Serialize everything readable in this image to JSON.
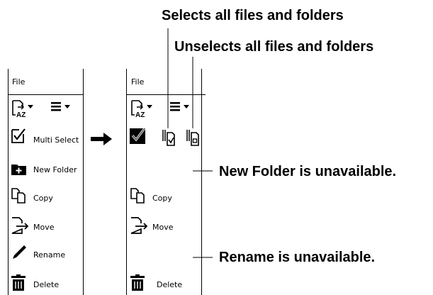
{
  "callouts": {
    "select_all": "Selects all files and folders",
    "unselect_all": "Unselects all files and folders",
    "new_folder_unavailable": "New Folder is unavailable.",
    "rename_unavailable": "Rename is unavailable."
  },
  "before_panel": {
    "file_label": "File",
    "items": [
      {
        "label": "Multi Select",
        "icon": "multi-select-icon"
      },
      {
        "label": "New Folder",
        "icon": "new-folder-icon"
      },
      {
        "label": "Copy",
        "icon": "copy-icon"
      },
      {
        "label": "Move",
        "icon": "move-icon"
      },
      {
        "label": "Rename",
        "icon": "rename-icon"
      },
      {
        "label": "Delete",
        "icon": "delete-icon"
      }
    ]
  },
  "after_panel": {
    "file_label": "File",
    "items": [
      {
        "label": "Copy",
        "icon": "copy-icon"
      },
      {
        "label": "Move",
        "icon": "move-icon"
      },
      {
        "label": "Delete",
        "icon": "delete-icon"
      }
    ]
  }
}
